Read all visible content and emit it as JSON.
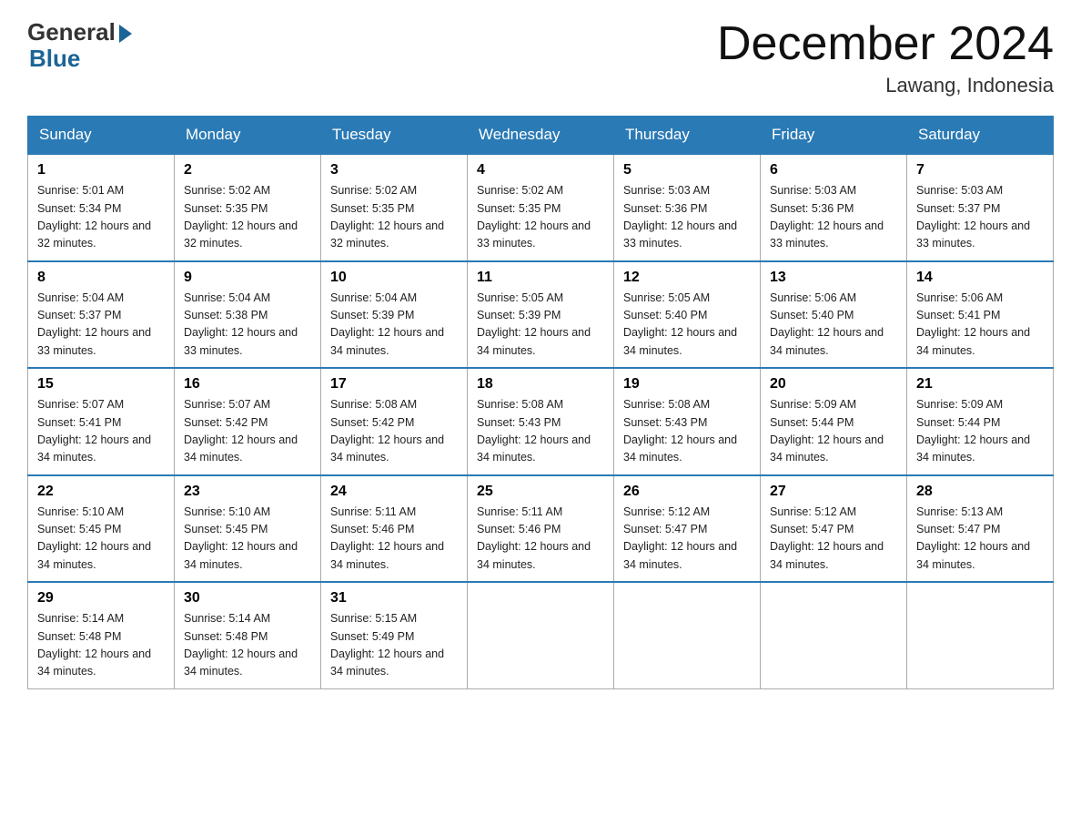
{
  "header": {
    "logo_general": "General",
    "logo_blue": "Blue",
    "month_title": "December 2024",
    "location": "Lawang, Indonesia"
  },
  "weekdays": [
    "Sunday",
    "Monday",
    "Tuesday",
    "Wednesday",
    "Thursday",
    "Friday",
    "Saturday"
  ],
  "weeks": [
    [
      {
        "day": "1",
        "sunrise": "5:01 AM",
        "sunset": "5:34 PM",
        "daylight": "12 hours and 32 minutes."
      },
      {
        "day": "2",
        "sunrise": "5:02 AM",
        "sunset": "5:35 PM",
        "daylight": "12 hours and 32 minutes."
      },
      {
        "day": "3",
        "sunrise": "5:02 AM",
        "sunset": "5:35 PM",
        "daylight": "12 hours and 32 minutes."
      },
      {
        "day": "4",
        "sunrise": "5:02 AM",
        "sunset": "5:35 PM",
        "daylight": "12 hours and 33 minutes."
      },
      {
        "day": "5",
        "sunrise": "5:03 AM",
        "sunset": "5:36 PM",
        "daylight": "12 hours and 33 minutes."
      },
      {
        "day": "6",
        "sunrise": "5:03 AM",
        "sunset": "5:36 PM",
        "daylight": "12 hours and 33 minutes."
      },
      {
        "day": "7",
        "sunrise": "5:03 AM",
        "sunset": "5:37 PM",
        "daylight": "12 hours and 33 minutes."
      }
    ],
    [
      {
        "day": "8",
        "sunrise": "5:04 AM",
        "sunset": "5:37 PM",
        "daylight": "12 hours and 33 minutes."
      },
      {
        "day": "9",
        "sunrise": "5:04 AM",
        "sunset": "5:38 PM",
        "daylight": "12 hours and 33 minutes."
      },
      {
        "day": "10",
        "sunrise": "5:04 AM",
        "sunset": "5:39 PM",
        "daylight": "12 hours and 34 minutes."
      },
      {
        "day": "11",
        "sunrise": "5:05 AM",
        "sunset": "5:39 PM",
        "daylight": "12 hours and 34 minutes."
      },
      {
        "day": "12",
        "sunrise": "5:05 AM",
        "sunset": "5:40 PM",
        "daylight": "12 hours and 34 minutes."
      },
      {
        "day": "13",
        "sunrise": "5:06 AM",
        "sunset": "5:40 PM",
        "daylight": "12 hours and 34 minutes."
      },
      {
        "day": "14",
        "sunrise": "5:06 AM",
        "sunset": "5:41 PM",
        "daylight": "12 hours and 34 minutes."
      }
    ],
    [
      {
        "day": "15",
        "sunrise": "5:07 AM",
        "sunset": "5:41 PM",
        "daylight": "12 hours and 34 minutes."
      },
      {
        "day": "16",
        "sunrise": "5:07 AM",
        "sunset": "5:42 PM",
        "daylight": "12 hours and 34 minutes."
      },
      {
        "day": "17",
        "sunrise": "5:08 AM",
        "sunset": "5:42 PM",
        "daylight": "12 hours and 34 minutes."
      },
      {
        "day": "18",
        "sunrise": "5:08 AM",
        "sunset": "5:43 PM",
        "daylight": "12 hours and 34 minutes."
      },
      {
        "day": "19",
        "sunrise": "5:08 AM",
        "sunset": "5:43 PM",
        "daylight": "12 hours and 34 minutes."
      },
      {
        "day": "20",
        "sunrise": "5:09 AM",
        "sunset": "5:44 PM",
        "daylight": "12 hours and 34 minutes."
      },
      {
        "day": "21",
        "sunrise": "5:09 AM",
        "sunset": "5:44 PM",
        "daylight": "12 hours and 34 minutes."
      }
    ],
    [
      {
        "day": "22",
        "sunrise": "5:10 AM",
        "sunset": "5:45 PM",
        "daylight": "12 hours and 34 minutes."
      },
      {
        "day": "23",
        "sunrise": "5:10 AM",
        "sunset": "5:45 PM",
        "daylight": "12 hours and 34 minutes."
      },
      {
        "day": "24",
        "sunrise": "5:11 AM",
        "sunset": "5:46 PM",
        "daylight": "12 hours and 34 minutes."
      },
      {
        "day": "25",
        "sunrise": "5:11 AM",
        "sunset": "5:46 PM",
        "daylight": "12 hours and 34 minutes."
      },
      {
        "day": "26",
        "sunrise": "5:12 AM",
        "sunset": "5:47 PM",
        "daylight": "12 hours and 34 minutes."
      },
      {
        "day": "27",
        "sunrise": "5:12 AM",
        "sunset": "5:47 PM",
        "daylight": "12 hours and 34 minutes."
      },
      {
        "day": "28",
        "sunrise": "5:13 AM",
        "sunset": "5:47 PM",
        "daylight": "12 hours and 34 minutes."
      }
    ],
    [
      {
        "day": "29",
        "sunrise": "5:14 AM",
        "sunset": "5:48 PM",
        "daylight": "12 hours and 34 minutes."
      },
      {
        "day": "30",
        "sunrise": "5:14 AM",
        "sunset": "5:48 PM",
        "daylight": "12 hours and 34 minutes."
      },
      {
        "day": "31",
        "sunrise": "5:15 AM",
        "sunset": "5:49 PM",
        "daylight": "12 hours and 34 minutes."
      },
      null,
      null,
      null,
      null
    ]
  ]
}
